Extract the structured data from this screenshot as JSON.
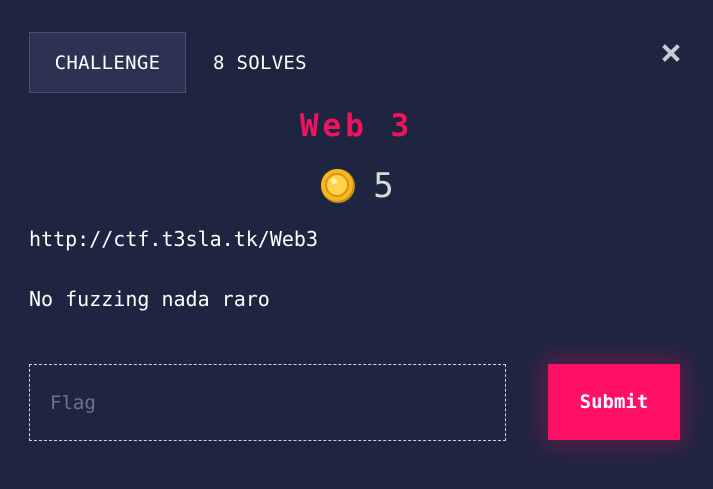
{
  "tabs": {
    "challenge_label": "CHALLENGE",
    "solves_label": "8 SOLVES"
  },
  "challenge": {
    "title": "Web 3",
    "points": "5",
    "description_lines": [
      "http://ctf.t3sla.tk/Web3",
      "No fuzzing nada raro"
    ]
  },
  "flag_form": {
    "placeholder": "Flag",
    "value": "",
    "submit_label": "Submit"
  },
  "icons": {
    "close": "close-icon",
    "coin": "coin-icon"
  },
  "colors": {
    "background": "#1e2540",
    "accent": "#ff1065",
    "title": "#f0145f",
    "coin": "#f5b820"
  }
}
